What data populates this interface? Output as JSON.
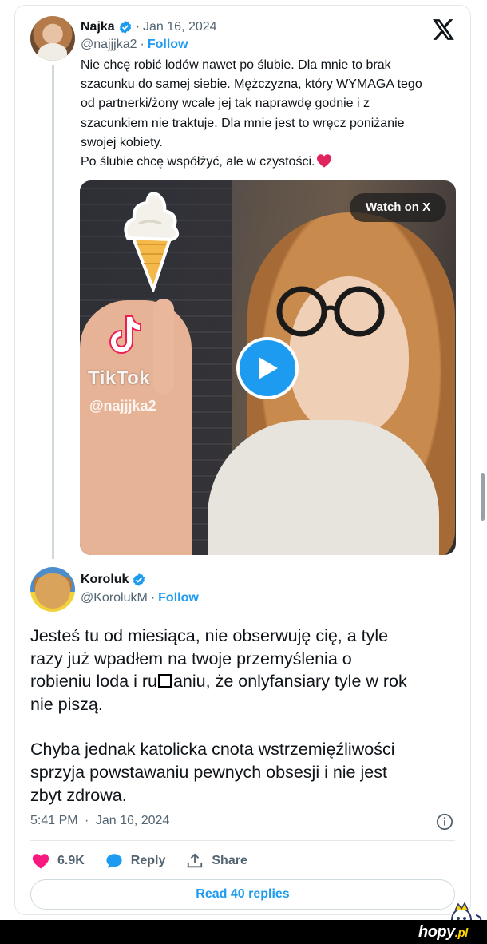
{
  "quoted_tweet": {
    "name": "Najka",
    "date": "Jan 16, 2024",
    "handle": "@najjjka2",
    "follow_label": "Follow",
    "text_lines": [
      "Nie chcę robić lodów nawet po ślubie. Dla mnie to brak",
      "szacunku do samej siebie. Mężczyzna, który WYMAGA tego",
      "od partnerki/żony wcale jej tak naprawdę godnie i z",
      "szacunkiem nie traktuje. Dla mnie jest to wręcz poniżanie",
      "swojej kobiety.",
      "Po ślubie chcę współżyć, ale w czystości."
    ],
    "media": {
      "watch_label": "Watch on X",
      "watermark_brand": "TikTok",
      "watermark_handle": "@najjjka2"
    }
  },
  "main_tweet": {
    "name": "Koroluk",
    "handle": "@KorolukM",
    "follow_label": "Follow",
    "para1": [
      "Jesteś tu od miesiąca, nie obserwuję cię, a tyle",
      "razy już wpadłem na twoje przemyślenia o",
      "nie piszą."
    ],
    "para1_line3_before": "robieniu loda i ru",
    "para1_line3_after": "aniu, że onlyfansiary tyle w rok",
    "para2": [
      "Chyba jednak katolicka cnota wstrzemięźliwości",
      "sprzyja powstawaniu pewnych obsesji i nie jest",
      "zbyt zdrowa."
    ],
    "time": "5:41 PM",
    "date": "Jan 16, 2024",
    "likes": "6.9K",
    "reply_label": "Reply",
    "share_label": "Share",
    "read_replies_label": "Read 40 replies"
  },
  "footer": {
    "brand": "hopy",
    "tld": ".pl"
  },
  "colors": {
    "accent": "#1d9bf0",
    "like": "#f91880",
    "secondary_text": "#536471",
    "heart_emoji": "#e0245e"
  },
  "icons": [
    "verified-badge-icon",
    "x-logo-icon",
    "heart-emoji-icon",
    "play-icon",
    "tiktok-logo-icon",
    "info-icon",
    "like-heart-icon",
    "reply-bubble-icon",
    "share-icon"
  ]
}
